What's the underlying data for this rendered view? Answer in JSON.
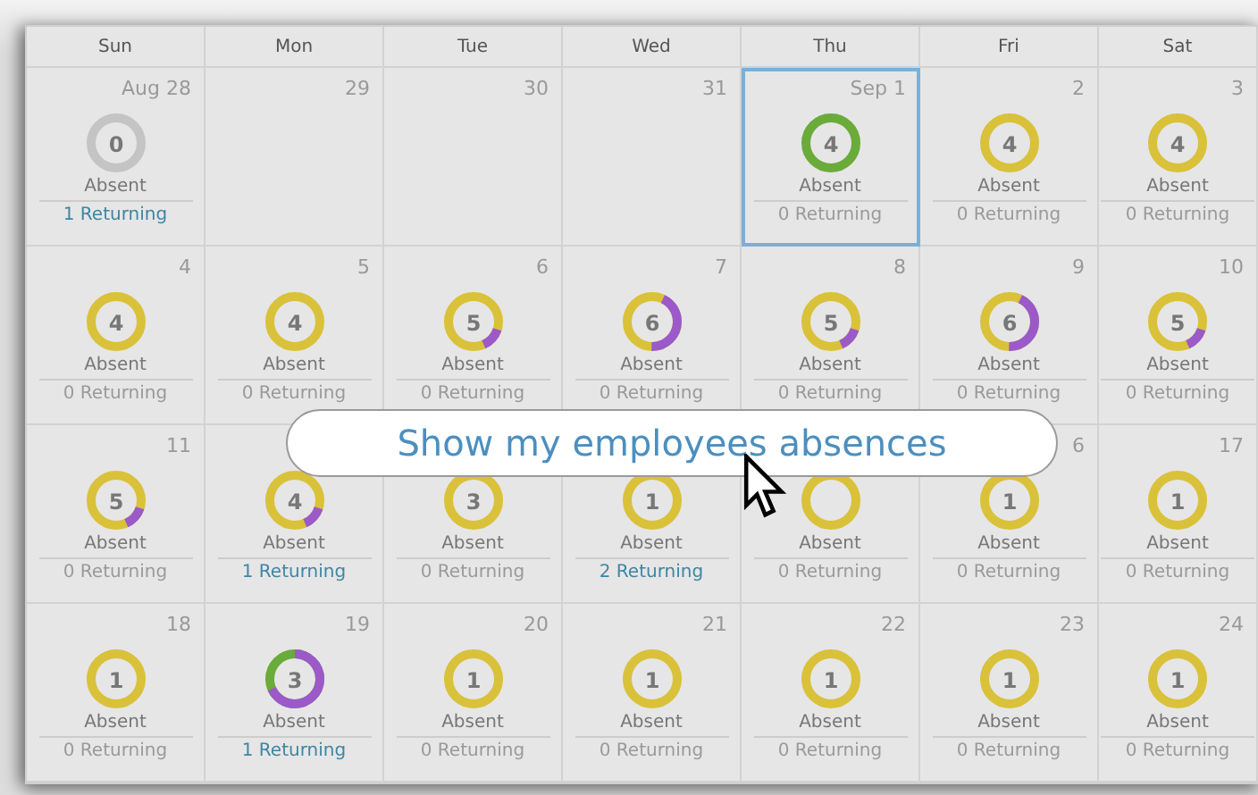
{
  "weekdays": [
    "Sun",
    "Mon",
    "Tue",
    "Wed",
    "Thu",
    "Fri",
    "Sat"
  ],
  "weeks": [
    {
      "days": [
        {
          "date": "Aug 28",
          "selected": false,
          "count": "0",
          "color": "#c4c4c4",
          "kind": "solid",
          "absent_label": "Absent",
          "returning": "1 Returning",
          "returning_active": true
        },
        {
          "date": "29",
          "selected": false
        },
        {
          "date": "30",
          "selected": false
        },
        {
          "date": "31",
          "selected": false
        },
        {
          "date": "Sep 1",
          "selected": true,
          "count": "4",
          "color": "#6aab3a",
          "kind": "solid",
          "absent_label": "Absent",
          "returning": "0 Returning",
          "returning_active": false
        },
        {
          "date": "2",
          "selected": false,
          "count": "4",
          "color": "#d9c13a",
          "kind": "solid",
          "absent_label": "Absent",
          "returning": "0 Returning",
          "returning_active": false
        },
        {
          "date": "3",
          "selected": false,
          "count": "4",
          "color": "#d9c13a",
          "kind": "solid",
          "absent_label": "Absent",
          "returning": "0 Returning",
          "returning_active": false
        }
      ]
    },
    {
      "days": [
        {
          "date": "4",
          "selected": false,
          "count": "4",
          "color": "#d9c13a",
          "kind": "solid",
          "absent_label": "Absent",
          "returning": "0 Returning",
          "returning_active": false
        },
        {
          "date": "5",
          "selected": false,
          "count": "4",
          "color": "#d9c13a",
          "kind": "solid",
          "absent_label": "Absent",
          "returning": "0 Returning",
          "returning_active": false
        },
        {
          "date": "6",
          "selected": false,
          "count": "5",
          "color": "#d9c13a",
          "kind": "minor-purple",
          "absent_label": "Absent",
          "returning": "0 Returning",
          "returning_active": false
        },
        {
          "date": "7",
          "selected": false,
          "count": "6",
          "color": "#d9c13a",
          "kind": "major-purple",
          "absent_label": "Absent",
          "returning": "0 Returning",
          "returning_active": false
        },
        {
          "date": "8",
          "selected": false,
          "count": "5",
          "color": "#d9c13a",
          "kind": "minor-purple",
          "absent_label": "Absent",
          "returning": "0 Returning",
          "returning_active": false
        },
        {
          "date": "9",
          "selected": false,
          "count": "6",
          "color": "#d9c13a",
          "kind": "major-purple",
          "absent_label": "Absent",
          "returning": "0 Returning",
          "returning_active": false
        },
        {
          "date": "10",
          "selected": false,
          "count": "5",
          "color": "#d9c13a",
          "kind": "minor-purple",
          "absent_label": "Absent",
          "returning": "0 Returning",
          "returning_active": false
        }
      ]
    },
    {
      "days": [
        {
          "date": "11",
          "selected": false,
          "count": "5",
          "color": "#d9c13a",
          "kind": "minor-purple",
          "absent_label": "Absent",
          "returning": "0 Returning",
          "returning_active": false
        },
        {
          "selected": false,
          "count": "4",
          "color": "#d9c13a",
          "kind": "minor-purple",
          "absent_label": "Absent",
          "returning": "1 Returning",
          "returning_active": true
        },
        {
          "selected": false,
          "count": "3",
          "color": "#d9c13a",
          "kind": "solid",
          "absent_label": "Absent",
          "returning": "0 Returning",
          "returning_active": false
        },
        {
          "selected": false,
          "count": "1",
          "color": "#d9c13a",
          "kind": "solid",
          "absent_label": "Absent",
          "returning": "2 Returning",
          "returning_active": true
        },
        {
          "selected": false,
          "color": "#d9c13a",
          "kind": "solid",
          "absent_label": "Absent",
          "returning": "0 Returning",
          "returning_active": false
        },
        {
          "date": "6",
          "selected": false,
          "count": "1",
          "color": "#d9c13a",
          "kind": "solid",
          "absent_label": "Absent",
          "returning": "0 Returning",
          "returning_active": false
        },
        {
          "date": "17",
          "selected": false,
          "count": "1",
          "color": "#d9c13a",
          "kind": "solid",
          "absent_label": "Absent",
          "returning": "0 Returning",
          "returning_active": false
        }
      ]
    },
    {
      "days": [
        {
          "date": "18",
          "selected": false,
          "count": "1",
          "color": "#d9c13a",
          "kind": "solid",
          "absent_label": "Absent",
          "returning": "0 Returning",
          "returning_active": false
        },
        {
          "date": "19",
          "selected": false,
          "count": "3",
          "color": "#6aab3a",
          "kind": "mostly-purple",
          "absent_label": "Absent",
          "returning": "1 Returning",
          "returning_active": true
        },
        {
          "date": "20",
          "selected": false,
          "count": "1",
          "color": "#d9c13a",
          "kind": "solid",
          "absent_label": "Absent",
          "returning": "0 Returning",
          "returning_active": false
        },
        {
          "date": "21",
          "selected": false,
          "count": "1",
          "color": "#d9c13a",
          "kind": "solid",
          "absent_label": "Absent",
          "returning": "0 Returning",
          "returning_active": false
        },
        {
          "date": "22",
          "selected": false,
          "count": "1",
          "color": "#d9c13a",
          "kind": "solid",
          "absent_label": "Absent",
          "returning": "0 Returning",
          "returning_active": false
        },
        {
          "date": "23",
          "selected": false,
          "count": "1",
          "color": "#d9c13a",
          "kind": "solid",
          "absent_label": "Absent",
          "returning": "0 Returning",
          "returning_active": false
        },
        {
          "date": "24",
          "selected": false,
          "count": "1",
          "color": "#d9c13a",
          "kind": "solid",
          "absent_label": "Absent",
          "returning": "0 Returning",
          "returning_active": false
        }
      ]
    }
  ],
  "overlay_button": {
    "label": "Show my employees absences"
  }
}
